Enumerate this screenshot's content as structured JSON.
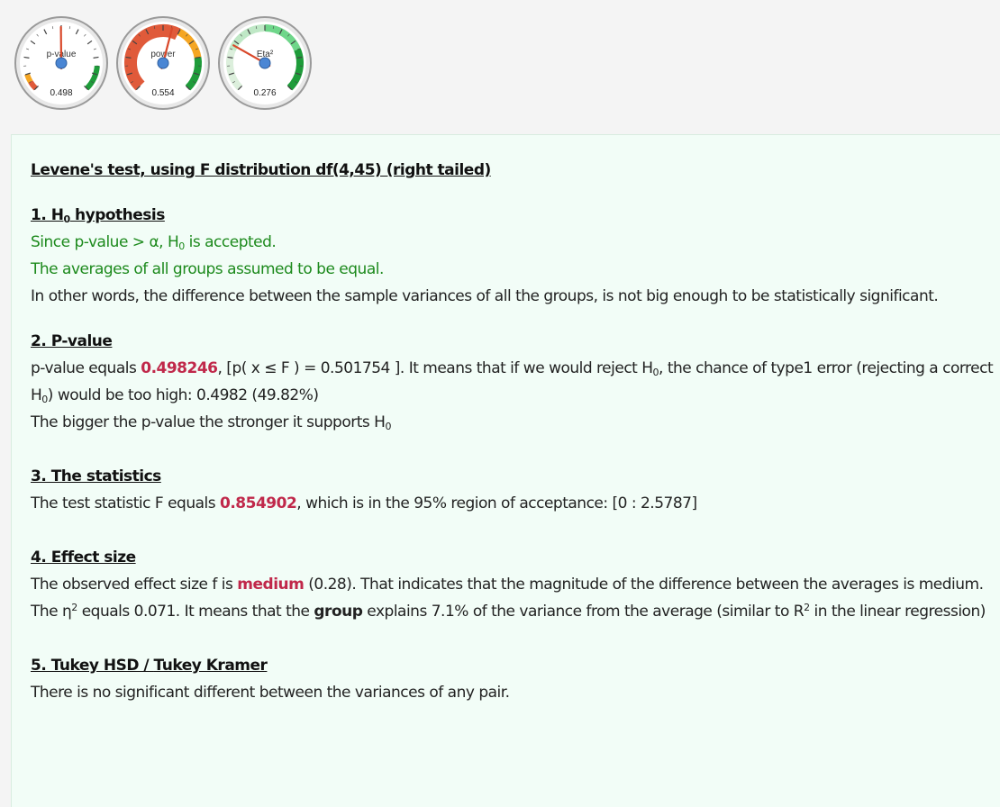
{
  "gauges": [
    {
      "label": "p-value",
      "value_text": "0.498",
      "value": 0.498,
      "face_color": "#ffffff",
      "needle_color": "#d9482a"
    },
    {
      "label": "power",
      "value_text": "0.554",
      "value": 0.554,
      "face_color": "#ffffff",
      "needle_color": "#d9482a"
    },
    {
      "label": "Eta²",
      "value_text": "0.276",
      "value": 0.276,
      "face_color": "#ffffff",
      "needle_color": "#d9482a"
    }
  ],
  "colors": {
    "green_text": "#1d8a1d",
    "highlight": "#c0284a",
    "panel_bg": "#f2fdf7",
    "gauge_red": "#e05a3a",
    "gauge_orange": "#f5a623",
    "gauge_green": "#1e9c3a",
    "gauge_light_green": "#6fd68a"
  },
  "report": {
    "title": "Levene's test, using F distribution df(4,45) (right tailed)",
    "s1": {
      "heading_pre": "1. H",
      "heading_sub": "0",
      "heading_post": " hypothesis",
      "line1_a": "Since p-value > α, H",
      "line1_sub": "0",
      "line1_b": " is accepted.",
      "line2": "The averages of all groups assumed to be equal.",
      "line3": "In other words, the difference between the sample variances of all the groups, is not big enough to be statistically significant."
    },
    "s2": {
      "heading": "2. P-value",
      "a": "p-value equals ",
      "pvalue": "0.498246",
      "b": ", [p( x ≤ F ) = 0.501754 ]. It means that if we would reject H",
      "sub1": "0",
      "c": ", the chance of type1 error (rejecting a correct H",
      "sub2": "0",
      "d": ") would be too high: 0.4982 (49.82%)",
      "line2_a": "The bigger the p-value the stronger it supports H",
      "line2_sub": "0"
    },
    "s3": {
      "heading": "3. The statistics",
      "a": "The test statistic F equals ",
      "fvalue": "0.854902",
      "b": ", which is in the 95% region of acceptance: [0 : 2.5787]"
    },
    "s4": {
      "heading": "4. Effect size",
      "a": "The observed effect size f is ",
      "size": "medium",
      "b": " (0.28). That indicates that the magnitude of the difference between the averages is medium.",
      "c": "The η",
      "sup1": "2",
      "d": " equals 0.071. It means that the ",
      "group": "group",
      "e": " explains 7.1% of the variance from the average (similar to R",
      "sup2": "2",
      "f": " in the linear regression)"
    },
    "s5": {
      "heading_a": "5. Tukey HSD",
      "heading_sep": " / ",
      "heading_b": "Tukey Kramer",
      "line": "There is no significant different between the variances of any pair."
    }
  }
}
